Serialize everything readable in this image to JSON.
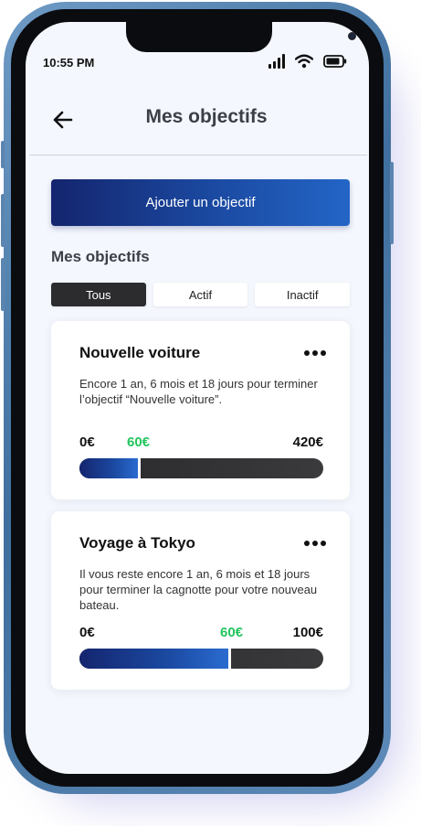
{
  "status_bar": {
    "time": "10:55 PM"
  },
  "header": {
    "title": "Mes objectifs"
  },
  "add_button": {
    "label": "Ajouter un objectif"
  },
  "section": {
    "title": "Mes objectifs"
  },
  "filters": [
    {
      "label": "Tous",
      "active": true
    },
    {
      "label": "Actif",
      "active": false
    },
    {
      "label": "Inactif",
      "active": false
    }
  ],
  "goals": [
    {
      "title": "Nouvelle voiture",
      "description": "Encore 1 an, 6 mois et 18 jours pour terminer l’objectif “Nouvelle voiture”.",
      "min_label": "0€",
      "current_label": "60€",
      "max_label": "420€",
      "progress": 0.25
    },
    {
      "title": "Voyage à Tokyo",
      "description": "Il vous reste encore 1 an, 6 mois et 18 jours pour terminer la cagnotte pour votre nouveau bateau.",
      "min_label": "0€",
      "current_label": "60€",
      "max_label": "100€",
      "progress": 0.62
    }
  ],
  "colors": {
    "accent_start": "#14256e",
    "accent_end": "#2365c6",
    "current_amount": "#22c55e",
    "active_filter": "#2c2c2e"
  }
}
